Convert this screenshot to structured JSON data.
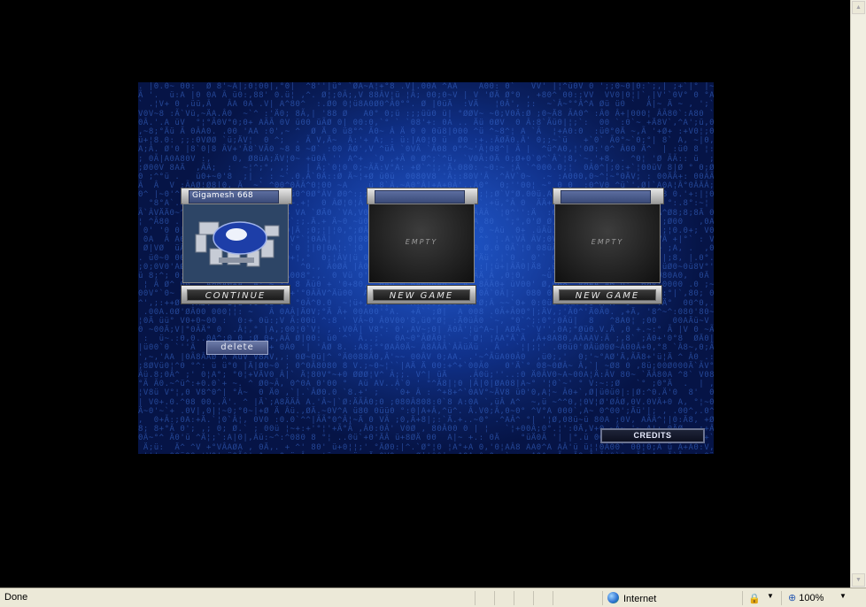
{
  "game": {
    "slots": [
      {
        "header": "Gigamesh 668",
        "screen": "",
        "button": "CONTINUE",
        "has_robot": true
      },
      {
        "header": "",
        "screen": "EMPTY",
        "button": "NEW GAME",
        "has_robot": false
      },
      {
        "header": "",
        "screen": "EMPTY",
        "button": "NEW GAME",
        "has_robot": false
      }
    ],
    "delete_label": "delete",
    "credits_label": "CREDITS",
    "background_color": "#1a46ad"
  },
  "statusbar": {
    "status": "Done",
    "zone": "Internet",
    "zoom": "100%"
  },
  "icons": {
    "zone": "globe-icon",
    "privacy": "privacy-icon",
    "zoom": "magnifier-icon"
  }
}
